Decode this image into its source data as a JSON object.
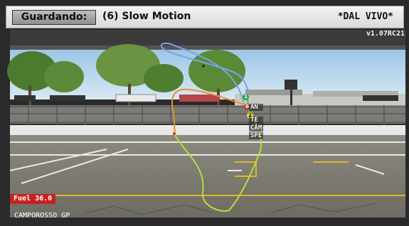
{
  "header": {
    "watch_button_label": "Guardando:",
    "camera_mode": "(6) Slow Motion",
    "live_label": "*DAL VIVO*"
  },
  "version": "v1.07RC21",
  "hud": {
    "fuel": "Fuel 36.0",
    "track_name": "CAMPOROSSO GP",
    "tags": [
      "AN",
      "TE",
      "CAM",
      "SPE"
    ],
    "markers": [
      "1",
      "6",
      "2"
    ]
  },
  "colors": {
    "fuel_badge": "#c52222",
    "track_line_start": "#7aa2e8",
    "track_line_mid": "#e8922e",
    "track_line_end": "#b3e032"
  }
}
